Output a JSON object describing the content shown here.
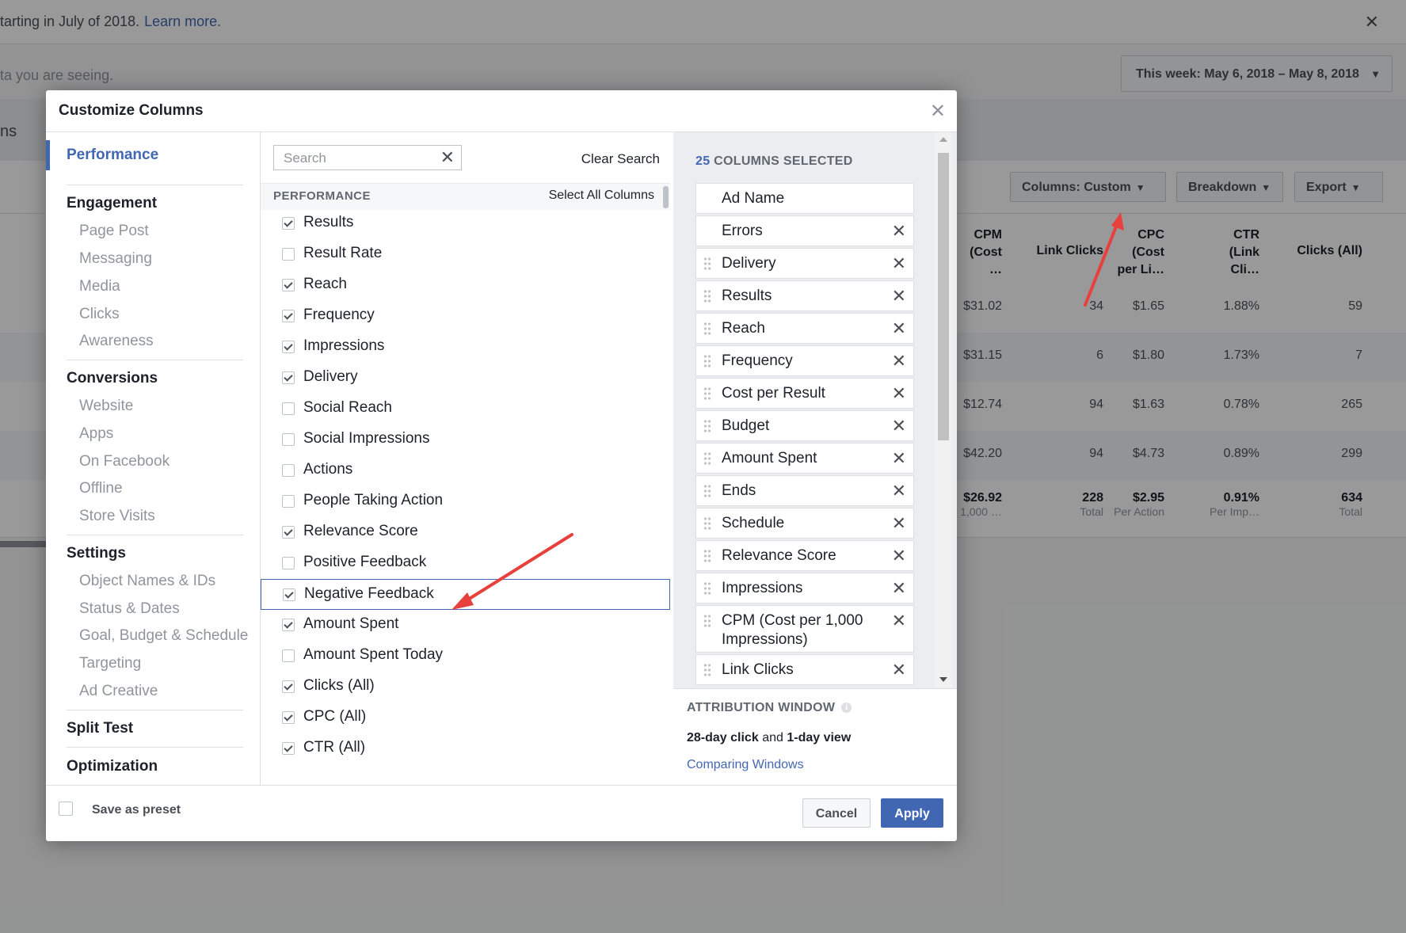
{
  "background": {
    "notice_text": "tarting in July of 2018.",
    "notice_link": "Learn more.",
    "subtext": "ta you are seeing.",
    "tab_fragment": "ns",
    "date_range": "This week: May 6, 2018 – May 8, 2018",
    "toolbar": {
      "columns": "Columns: Custom",
      "breakdown": "Breakdown",
      "export": "Export"
    },
    "grid_headers": [
      {
        "line1": "CPM",
        "line2": "(Cost",
        "line3": "…"
      },
      {
        "line1": "Link Clicks",
        "line2": "",
        "line3": ""
      },
      {
        "line1": "CPC",
        "line2": "(Cost",
        "line3": "per Li…"
      },
      {
        "line1": "CTR",
        "line2": "(Link",
        "line3": "Cli…"
      },
      {
        "line1": "Clicks (All)",
        "line2": "",
        "line3": ""
      }
    ],
    "grid_rows": [
      [
        "$31.02",
        "34",
        "$1.65",
        "1.88%",
        "59"
      ],
      [
        "$31.15",
        "6",
        "$1.80",
        "1.73%",
        "7"
      ],
      [
        "$12.74",
        "94",
        "$1.63",
        "0.78%",
        "265"
      ],
      [
        "$42.20",
        "94",
        "$4.73",
        "0.89%",
        "299"
      ]
    ],
    "totals": [
      {
        "v": "$26.92",
        "s": "1,000 …"
      },
      {
        "v": "228",
        "s": "Total"
      },
      {
        "v": "$2.95",
        "s": "Per Action"
      },
      {
        "v": "0.91%",
        "s": "Per Imp…"
      },
      {
        "v": "634",
        "s": "Total"
      }
    ]
  },
  "modal": {
    "title": "Customize Columns",
    "close_icon": "close-icon",
    "nav": {
      "performance": "Performance",
      "engagement": "Engagement",
      "engagement_items": [
        "Page Post",
        "Messaging",
        "Media",
        "Clicks",
        "Awareness"
      ],
      "conversions": "Conversions",
      "conversions_items": [
        "Website",
        "Apps",
        "On Facebook",
        "Offline",
        "Store Visits"
      ],
      "settings": "Settings",
      "settings_items": [
        "Object Names & IDs",
        "Status & Dates",
        "Goal, Budget & Schedule",
        "Targeting",
        "Ad Creative"
      ],
      "split_test": "Split Test",
      "optimization": "Optimization"
    },
    "search": {
      "placeholder": "Search",
      "value": "",
      "clear_label": "Clear Search"
    },
    "section": {
      "title": "PERFORMANCE",
      "select_all": "Select All Columns"
    },
    "options": [
      {
        "label": "Results",
        "checked": true
      },
      {
        "label": "Result Rate",
        "checked": false
      },
      {
        "label": "Reach",
        "checked": true
      },
      {
        "label": "Frequency",
        "checked": true
      },
      {
        "label": "Impressions",
        "checked": true
      },
      {
        "label": "Delivery",
        "checked": true
      },
      {
        "label": "Social Reach",
        "checked": false
      },
      {
        "label": "Social Impressions",
        "checked": false
      },
      {
        "label": "Actions",
        "checked": false
      },
      {
        "label": "People Taking Action",
        "checked": false
      },
      {
        "label": "Relevance Score",
        "checked": true
      },
      {
        "label": "Positive Feedback",
        "checked": false
      },
      {
        "label": "Negative Feedback",
        "checked": true,
        "highlighted": true
      },
      {
        "label": "Amount Spent",
        "checked": true
      },
      {
        "label": "Amount Spent Today",
        "checked": false
      },
      {
        "label": "Clicks (All)",
        "checked": true
      },
      {
        "label": "CPC (All)",
        "checked": true
      },
      {
        "label": "CTR (All)",
        "checked": true
      }
    ],
    "selected": {
      "count": "25",
      "label": "COLUMNS SELECTED",
      "columns": [
        {
          "label": "Ad Name",
          "fixed": true
        },
        {
          "label": "Errors",
          "fixed": true,
          "removable": true
        },
        {
          "label": "Delivery"
        },
        {
          "label": "Results"
        },
        {
          "label": "Reach"
        },
        {
          "label": "Frequency"
        },
        {
          "label": "Cost per Result"
        },
        {
          "label": "Budget"
        },
        {
          "label": "Amount Spent"
        },
        {
          "label": "Ends"
        },
        {
          "label": "Schedule"
        },
        {
          "label": "Relevance Score"
        },
        {
          "label": "Impressions"
        },
        {
          "label": "CPM (Cost per 1,000 Impressions)",
          "tall": true
        },
        {
          "label": "Link Clicks"
        }
      ]
    },
    "attribution": {
      "title": "ATTRIBUTION WINDOW",
      "click": "28-day click",
      "and": "and",
      "view": "1-day view",
      "link": "Comparing Windows"
    },
    "footer": {
      "preset_label": "Save as preset",
      "cancel": "Cancel",
      "apply": "Apply"
    }
  },
  "colors": {
    "accent": "#4267b2",
    "arrow": "#e8403d"
  }
}
